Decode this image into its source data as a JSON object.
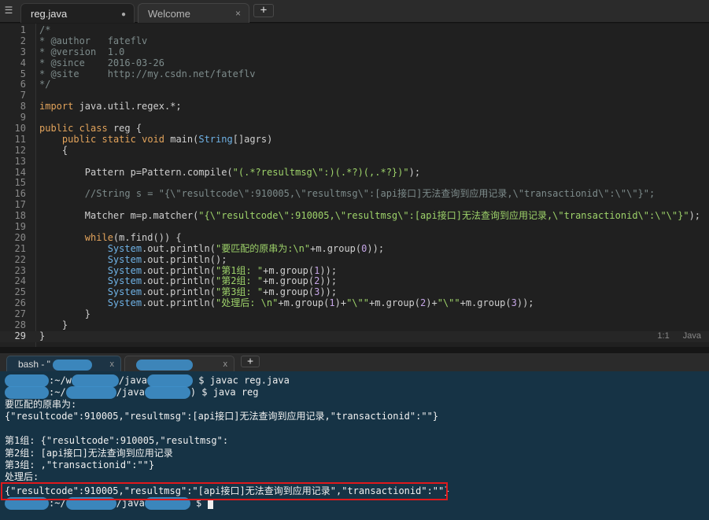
{
  "editor_tabs": [
    {
      "label": "reg.java",
      "modified": true
    },
    {
      "label": "Welcome"
    }
  ],
  "new_tab_symbol": "+",
  "code_lines": [
    [
      {
        "t": "/*",
        "c": "comment"
      }
    ],
    [
      {
        "t": "* @author   fateflv",
        "c": "comment"
      }
    ],
    [
      {
        "t": "* @version  1.0",
        "c": "comment"
      }
    ],
    [
      {
        "t": "* @since    2016-03-26",
        "c": "comment"
      }
    ],
    [
      {
        "t": "* @site     http://my.csdn.net/fateflv",
        "c": "comment"
      }
    ],
    [
      {
        "t": "*/",
        "c": "comment"
      }
    ],
    [],
    [
      {
        "t": "import",
        "c": "kw"
      },
      {
        "t": " java.util.regex.*;",
        "c": "plain"
      }
    ],
    [],
    [
      {
        "t": "public",
        "c": "kw"
      },
      {
        "t": " ",
        "c": "plain"
      },
      {
        "t": "class",
        "c": "kw"
      },
      {
        "t": " reg {",
        "c": "plain"
      }
    ],
    [
      {
        "t": "    ",
        "c": "plain"
      },
      {
        "t": "public",
        "c": "kw"
      },
      {
        "t": " ",
        "c": "plain"
      },
      {
        "t": "static",
        "c": "kw"
      },
      {
        "t": " ",
        "c": "plain"
      },
      {
        "t": "void",
        "c": "kw"
      },
      {
        "t": " main(",
        "c": "plain"
      },
      {
        "t": "String",
        "c": "type"
      },
      {
        "t": "[]agrs)",
        "c": "plain"
      }
    ],
    [
      {
        "t": "    {",
        "c": "plain"
      }
    ],
    [],
    [
      {
        "t": "        Pattern p=Pattern.compile(",
        "c": "plain"
      },
      {
        "t": "\"(.*?resultmsg\\\":)(.*?)(,.*?})\"",
        "c": "str"
      },
      {
        "t": ");",
        "c": "plain"
      }
    ],
    [],
    [
      {
        "t": "        //String s = \"{\\\"resultcode\\\":910005,\\\"resultmsg\\\":[api接口]无法查询到应用记录,\\\"transactionid\\\":\\\"\\\"}\";",
        "c": "comment"
      }
    ],
    [],
    [
      {
        "t": "        Matcher m=p.matcher(",
        "c": "plain"
      },
      {
        "t": "\"{\\\"resultcode\\\":910005,\\\"resultmsg\\\":[api接口]无法查询到应用记录,\\\"transactionid\\\":\\\"\\\"}\"",
        "c": "str"
      },
      {
        "t": ");",
        "c": "plain"
      }
    ],
    [],
    [
      {
        "t": "        ",
        "c": "plain"
      },
      {
        "t": "while",
        "c": "kw"
      },
      {
        "t": "(m.find()) {",
        "c": "plain"
      }
    ],
    [
      {
        "t": "            ",
        "c": "plain"
      },
      {
        "t": "System",
        "c": "type"
      },
      {
        "t": ".out.println(",
        "c": "plain"
      },
      {
        "t": "\"要匹配的原串为:\\n\"",
        "c": "str"
      },
      {
        "t": "+m.group(",
        "c": "plain"
      },
      {
        "t": "0",
        "c": "num"
      },
      {
        "t": "));",
        "c": "plain"
      }
    ],
    [
      {
        "t": "            ",
        "c": "plain"
      },
      {
        "t": "System",
        "c": "type"
      },
      {
        "t": ".out.println();",
        "c": "plain"
      }
    ],
    [
      {
        "t": "            ",
        "c": "plain"
      },
      {
        "t": "System",
        "c": "type"
      },
      {
        "t": ".out.println(",
        "c": "plain"
      },
      {
        "t": "\"第1组: \"",
        "c": "str"
      },
      {
        "t": "+m.group(",
        "c": "plain"
      },
      {
        "t": "1",
        "c": "num"
      },
      {
        "t": "));",
        "c": "plain"
      }
    ],
    [
      {
        "t": "            ",
        "c": "plain"
      },
      {
        "t": "System",
        "c": "type"
      },
      {
        "t": ".out.println(",
        "c": "plain"
      },
      {
        "t": "\"第2组: \"",
        "c": "str"
      },
      {
        "t": "+m.group(",
        "c": "plain"
      },
      {
        "t": "2",
        "c": "num"
      },
      {
        "t": "));",
        "c": "plain"
      }
    ],
    [
      {
        "t": "            ",
        "c": "plain"
      },
      {
        "t": "System",
        "c": "type"
      },
      {
        "t": ".out.println(",
        "c": "plain"
      },
      {
        "t": "\"第3组: \"",
        "c": "str"
      },
      {
        "t": "+m.group(",
        "c": "plain"
      },
      {
        "t": "3",
        "c": "num"
      },
      {
        "t": "));",
        "c": "plain"
      }
    ],
    [
      {
        "t": "            ",
        "c": "plain"
      },
      {
        "t": "System",
        "c": "type"
      },
      {
        "t": ".out.println(",
        "c": "plain"
      },
      {
        "t": "\"处理后: \\n\"",
        "c": "str"
      },
      {
        "t": "+m.group(",
        "c": "plain"
      },
      {
        "t": "1",
        "c": "num"
      },
      {
        "t": ")+",
        "c": "plain"
      },
      {
        "t": "\"\\\"\"",
        "c": "str"
      },
      {
        "t": "+m.group(",
        "c": "plain"
      },
      {
        "t": "2",
        "c": "num"
      },
      {
        "t": ")+",
        "c": "plain"
      },
      {
        "t": "\"\\\"\"",
        "c": "str"
      },
      {
        "t": "+m.group(",
        "c": "plain"
      },
      {
        "t": "3",
        "c": "num"
      },
      {
        "t": "));",
        "c": "plain"
      }
    ],
    [
      {
        "t": "        }",
        "c": "plain"
      }
    ],
    [
      {
        "t": "    }",
        "c": "plain"
      }
    ],
    [
      {
        "t": "}",
        "c": "plain"
      }
    ]
  ],
  "current_line": 29,
  "status": {
    "position": "1:1",
    "language": "Java"
  },
  "terminal_tabs": [
    {
      "label": "bash - \"",
      "close": "x"
    },
    {
      "label": "",
      "close": "x"
    }
  ],
  "terminal": {
    "prompt1_path": ":~/w",
    "prompt1_dir": "/java",
    "cmd1": "$ javac reg.java",
    "prompt2_path": ":~/",
    "prompt2_dir": "/java",
    "cmd2": ") $ java reg",
    "output": [
      "要匹配的原串为:",
      "{\"resultcode\":910005,\"resultmsg\":[api接口]无法查询到应用记录,\"transactionid\":\"\"}",
      "",
      "第1组: {\"resultcode\":910005,\"resultmsg\":",
      "第2组: [api接口]无法查询到应用记录",
      "第3组: ,\"transactionid\":\"\"}",
      "处理后:",
      "{\"resultcode\":910005,\"resultmsg\":\"[api接口]无法查询到应用记录\",\"transactionid\":\"\"}"
    ],
    "prompt3_path": ":~/",
    "prompt3_dir": "/java",
    "prompt3_end": "$"
  },
  "colors": {
    "highlight_box": "#e0191c",
    "terminal_bg": "#163345",
    "editor_bg": "#202020"
  }
}
